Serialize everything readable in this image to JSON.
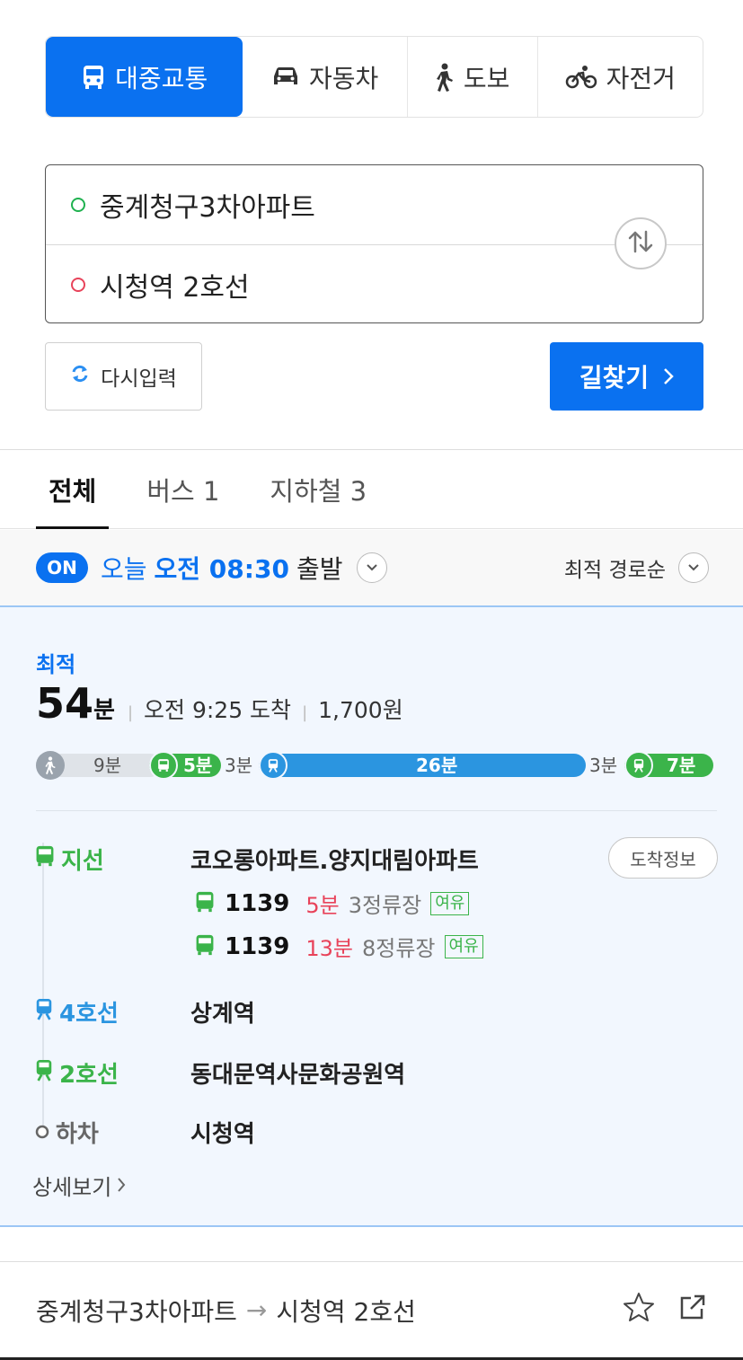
{
  "colors": {
    "accent": "#0a71f0",
    "bus_green": "#3bb44a",
    "subway_blue": "#2b95e0",
    "delay_red": "#e8435a"
  },
  "modes": [
    {
      "label": "대중교통",
      "icon": "bus-icon",
      "active": true
    },
    {
      "label": "자동차",
      "icon": "car-icon",
      "active": false
    },
    {
      "label": "도보",
      "icon": "walk-icon",
      "active": false
    },
    {
      "label": "자전거",
      "icon": "bicycle-icon",
      "active": false
    }
  ],
  "route": {
    "origin": "중계청구3차아파트",
    "destination": "시청역 2호선"
  },
  "buttons": {
    "reset": "다시입력",
    "search": "길찾기"
  },
  "tabs": [
    {
      "label": "전체"
    },
    {
      "label": "버스 1"
    },
    {
      "label": "지하철 3"
    }
  ],
  "departure": {
    "badge": "ON",
    "today": "오늘",
    "time": "오전 08:30",
    "suffix": "출발",
    "sort": "최적 경로순"
  },
  "result": {
    "tag": "최적",
    "duration_num": "54",
    "duration_unit": "분",
    "arrival": "오전 9:25 도착",
    "fare": "1,700원",
    "segments": [
      {
        "type": "walk",
        "label": "9분"
      },
      {
        "type": "bus",
        "label": "5분"
      },
      {
        "type": "gap",
        "label": "3분"
      },
      {
        "type": "subway",
        "label": "26분"
      },
      {
        "type": "gap",
        "label": "3분"
      },
      {
        "type": "subway-green",
        "label": "7분"
      }
    ],
    "steps": [
      {
        "line": "지선",
        "stop": "코오롱아파트.양지대림아파트"
      },
      {
        "line": "4호선",
        "stop": "상계역"
      },
      {
        "line": "2호선",
        "stop": "동대문역사문화공원역"
      },
      {
        "line": "하차",
        "stop": "시청역"
      }
    ],
    "arrival_info": "도착정보",
    "buses": [
      {
        "number": "1139",
        "minutes": "5분",
        "stops": "3정류장",
        "crowd": "여유"
      },
      {
        "number": "1139",
        "minutes": "13분",
        "stops": "8정류장",
        "crowd": "여유"
      }
    ],
    "detail": "상세보기"
  },
  "footer": {
    "origin": "중계청구3차아파트",
    "arrow": "→",
    "destination": "시청역 2호선"
  }
}
